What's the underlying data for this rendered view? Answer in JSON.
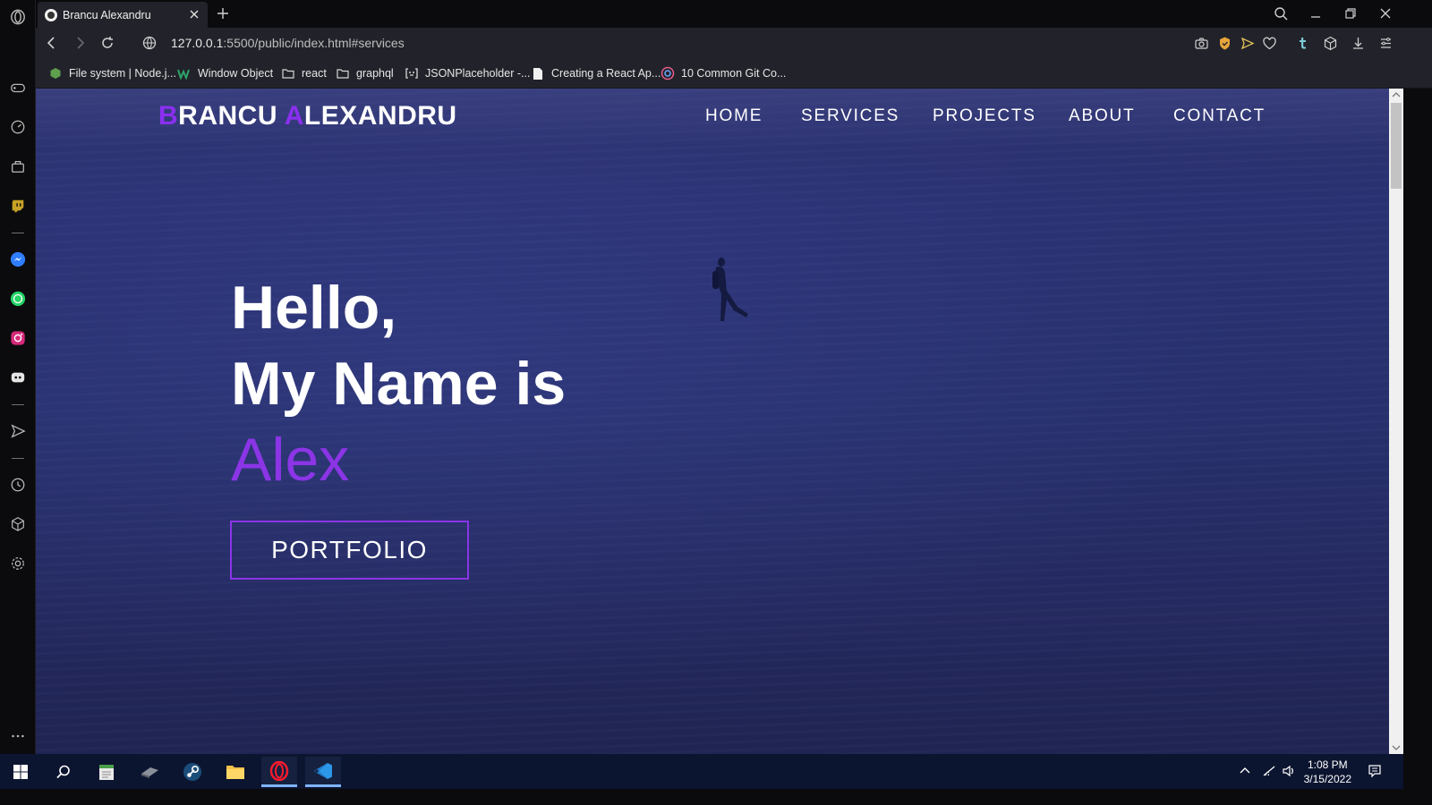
{
  "browser": {
    "tab_title": "Brancu Alexandru",
    "url_host": "127.0.0.1",
    "url_rest": ":5500/public/index.html#services",
    "bookmarks": [
      {
        "label": "File system | Node.j...",
        "icon": "nodejs-icon"
      },
      {
        "label": "Window Object",
        "icon": "w3schools-icon"
      },
      {
        "label": "react",
        "icon": "folder-icon"
      },
      {
        "label": "graphql",
        "icon": "folder-icon"
      },
      {
        "label": "JSONPlaceholder -...",
        "icon": "jsonplaceholder-icon"
      },
      {
        "label": "Creating a React Ap...",
        "icon": "document-icon"
      },
      {
        "label": "10 Common Git Co...",
        "icon": "git-icon"
      }
    ]
  },
  "site": {
    "logo_b": "B",
    "logo_rest1": "RANCU ",
    "logo_a": "A",
    "logo_rest2": "LEXANDRU",
    "nav": [
      "HOME",
      "SERVICES",
      "PROJECTS",
      "ABOUT",
      "CONTACT"
    ],
    "hero_line1": "Hello,",
    "hero_line2": "My Name is",
    "hero_name": "Alex",
    "cta": "PORTFOLIO"
  },
  "taskbar": {
    "time": "1:08 PM",
    "date": "3/15/2022"
  },
  "colors": {
    "accent": "#8b35e6",
    "page_bg": "#27306c",
    "taskbar": "#0c1530"
  }
}
